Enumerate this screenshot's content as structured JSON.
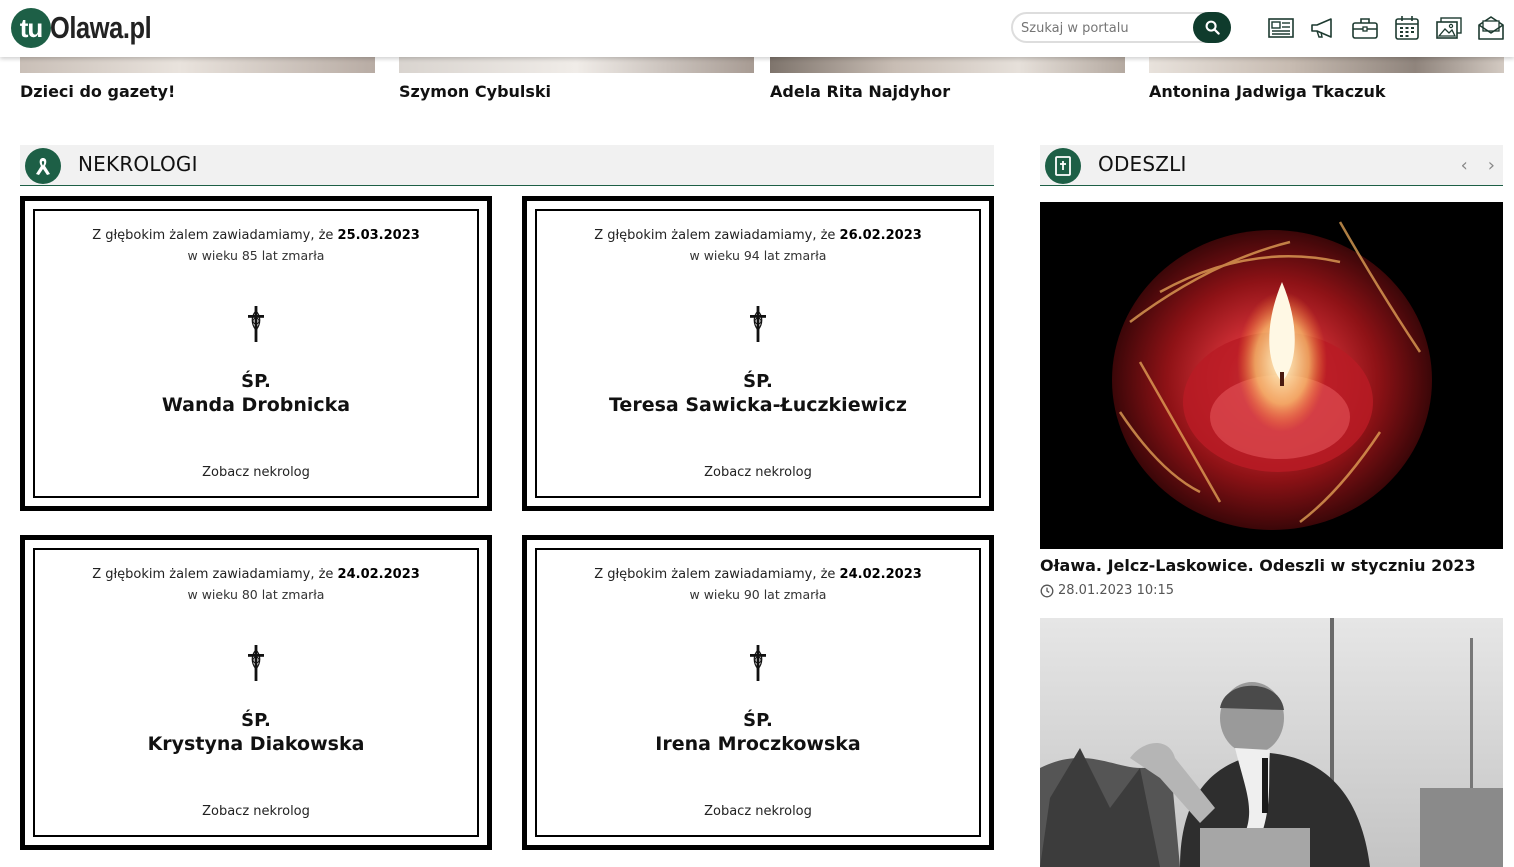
{
  "header": {
    "logo_badge": "tu",
    "logo_text": "Olawa.pl",
    "search_placeholder": "Szukaj w portalu",
    "icons": [
      "newspaper-icon",
      "megaphone-icon",
      "briefcase-icon",
      "calendar-icon",
      "photos-icon",
      "mail-icon"
    ]
  },
  "top_articles": [
    {
      "title": "Dzieci do gazety!"
    },
    {
      "title": "Szymon Cybulski"
    },
    {
      "title": "Adela Rita Najdyhor"
    },
    {
      "title": "Antonina Jadwiga Tkaczuk"
    }
  ],
  "nekrologi": {
    "title": "NEKROLOGI",
    "icon": "ribbon-icon",
    "cards": [
      {
        "intro": "Z głębokim żalem zawiadamiamy, że ",
        "date": "25.03.2023",
        "age_text": "w wieku 85 lat zmarła",
        "prefix": "ŚP.",
        "name": "Wanda Drobnicka",
        "link": "Zobacz nekrolog"
      },
      {
        "intro": "Z głębokim żalem zawiadamiamy, że ",
        "date": "26.02.2023",
        "age_text": "w wieku 94 lat zmarła",
        "prefix": "ŚP.",
        "name": "Teresa Sawicka-Łuczkiewicz",
        "link": "Zobacz nekrolog"
      },
      {
        "intro": "Z głębokim żalem zawiadamiamy, że ",
        "date": "24.02.2023",
        "age_text": "w wieku 80 lat zmarła",
        "prefix": "ŚP.",
        "name": "Krystyna Diakowska",
        "link": "Zobacz nekrolog"
      },
      {
        "intro": "Z głębokim żalem zawiadamiamy, że ",
        "date": "24.02.2023",
        "age_text": "w wieku 90 lat zmarła",
        "prefix": "ŚP.",
        "name": "Irena Mroczkowska",
        "link": "Zobacz nekrolog"
      }
    ]
  },
  "odeszli": {
    "title": "ODESZLI",
    "icon": "memorial-book-icon",
    "prev_label": "‹",
    "next_label": "›",
    "article": {
      "title": "Oława. Jelcz-Laskowice. Odeszli w styczniu 2023",
      "date": "28.01.2023 10:15"
    }
  },
  "colors": {
    "brand": "#1d5f46",
    "search_button": "#0f3b2c",
    "header_bg": "#f1f1f1"
  }
}
